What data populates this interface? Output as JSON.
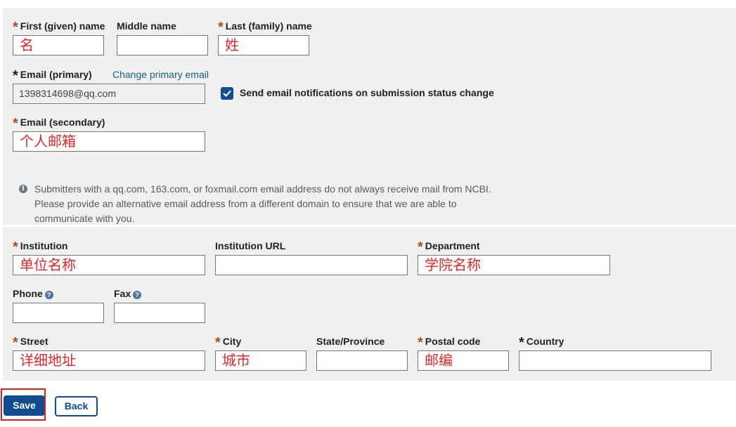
{
  "name": {
    "first_label": "First (given) name",
    "first_value": "名",
    "middle_label": "Middle name",
    "middle_value": "",
    "last_label": "Last (family) name",
    "last_value": "姓"
  },
  "email": {
    "primary_label": "Email (primary)",
    "change_link": "Change primary email",
    "primary_value": "1398314698@qq.com",
    "notify_label": "Send email notifications on submission status change",
    "notify_checked": true,
    "secondary_label": "Email (secondary)",
    "secondary_value": "个人邮箱",
    "info_icon": "info-icon",
    "info_text": "Submitters with a qq.com, 163.com, or foxmail.com email address do not always receive mail from NCBI. Please provide an alternative email address from a different domain to ensure that we are able to communicate with you."
  },
  "institution": {
    "institution_label": "Institution",
    "institution_value": "单位名称",
    "url_label": "Institution URL",
    "url_value": "",
    "department_label": "Department",
    "department_value": "学院名称"
  },
  "contact": {
    "phone_label": "Phone",
    "phone_value": "",
    "fax_label": "Fax",
    "fax_value": "",
    "help_glyph": "?"
  },
  "address": {
    "street_label": "Street",
    "street_value": "详细地址",
    "city_label": "City",
    "city_value": "城市",
    "state_label": "State/Province",
    "state_value": "",
    "postal_label": "Postal code",
    "postal_value": "邮编",
    "country_label": "Country",
    "country_value": ""
  },
  "buttons": {
    "save": "Save",
    "back": "Back"
  },
  "colors": {
    "required_star": "#a4512b",
    "input_text": "#e5262a",
    "primary_button": "#0f4d90",
    "link": "#1a5f8c",
    "highlight_box": "#e02020"
  },
  "glyphs": {
    "required": "*",
    "info": "i"
  }
}
